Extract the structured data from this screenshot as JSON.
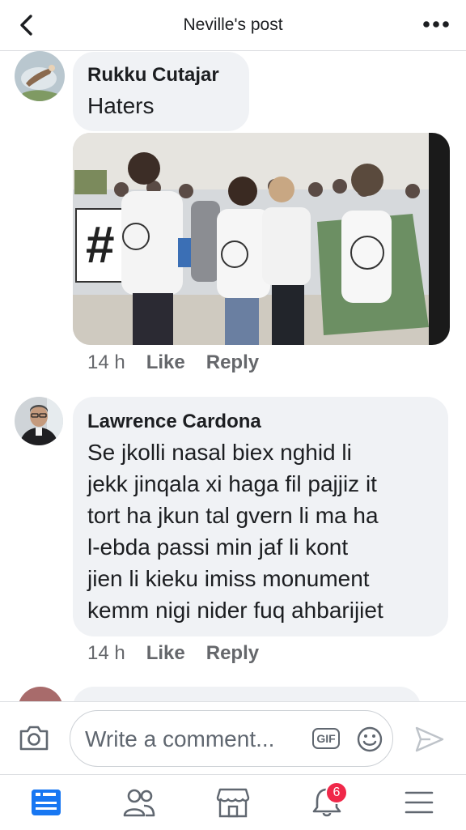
{
  "header": {
    "title": "Neville's post"
  },
  "comments": [
    {
      "author": "Rukku Cutajar",
      "text": "Haters",
      "time": "14 h",
      "like": "Like",
      "reply": "Reply"
    },
    {
      "author": "Lawrence Cardona",
      "text": "Se jkolli nasal biex nghid li\njekk jinqala xi haga fil pajjiz it\ntort ha jkun tal gvern li ma ha\nl-ebda passi min jaf li kont\njien li kieku imiss monument\nkemm nigi nider fuq ahbarijiet",
      "time": "14 h",
      "like": "Like",
      "reply": "Reply"
    }
  ],
  "composer": {
    "placeholder": "Write a comment...",
    "gif_label": "GIF"
  },
  "nav": {
    "notification_count": "6"
  },
  "colors": {
    "accent": "#1877f2",
    "bubble": "#f0f2f5",
    "badge": "#f02849",
    "muted": "#65676b"
  },
  "icons": [
    "back-arrow-icon",
    "more-dots-icon",
    "camera-icon",
    "gif-icon",
    "emoji-icon",
    "send-icon",
    "news-feed-icon",
    "friends-icon",
    "marketplace-icon",
    "notifications-bell-icon",
    "menu-icon"
  ]
}
